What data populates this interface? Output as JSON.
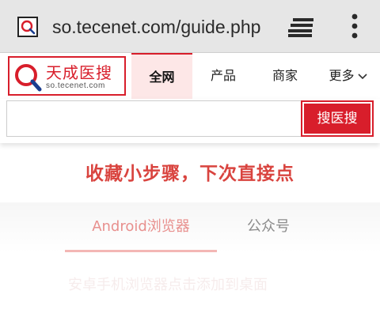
{
  "browser": {
    "url": "so.tecenet.com/guide.php",
    "icons": {
      "favicon": "search-logo-icon",
      "tabs": "tabs-icon",
      "menu": "vertical-dots-icon"
    }
  },
  "site": {
    "logo": {
      "name": "天成医搜",
      "domain": "so.tecenet.com"
    },
    "nav": [
      "全网",
      "产品",
      "商家",
      "更多"
    ],
    "search": {
      "value": "",
      "button": "搜医搜"
    },
    "accent": "#d81e2b"
  },
  "promo": {
    "text": "收藏小步骤，下次直接点"
  },
  "subtabs": [
    "Android浏览器",
    "公众号"
  ],
  "faded_text": "安卓手机浏览器点击添加到桌面"
}
